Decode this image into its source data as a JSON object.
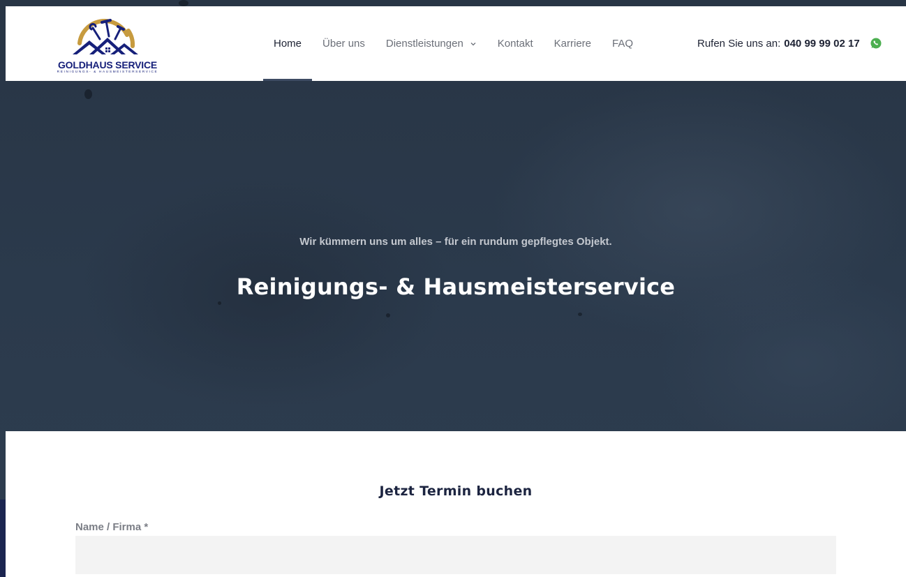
{
  "brand": {
    "name": "GOLDHAUS SERVICE",
    "tagline": "REINIGUNGS- & HAUSMEISTERSERVICE",
    "colors": {
      "navy": "#16207a",
      "gold": "#c79b3f"
    }
  },
  "nav": {
    "items": [
      {
        "label": "Home",
        "active": true
      },
      {
        "label": "Über uns",
        "active": false
      },
      {
        "label": "Dienstleistungen",
        "active": false,
        "has_dropdown": true
      },
      {
        "label": "Kontakt",
        "active": false
      },
      {
        "label": "Karriere",
        "active": false
      },
      {
        "label": "FAQ",
        "active": false
      }
    ]
  },
  "contact": {
    "phone_prefix": "Rufen Sie uns an:",
    "phone_number": "040 99 99 02 17",
    "whatsapp_icon": "whatsapp-icon",
    "whatsapp_color": "#4caf50"
  },
  "hero": {
    "subtitle": "Wir kümmern uns um alles – für ein rundum gepflegtes Objekt.",
    "title": "Reinigungs- & Hausmeisterservice"
  },
  "booking": {
    "title": "Jetzt Termin buchen",
    "name_label": "Name / Firma *",
    "name_value": ""
  }
}
